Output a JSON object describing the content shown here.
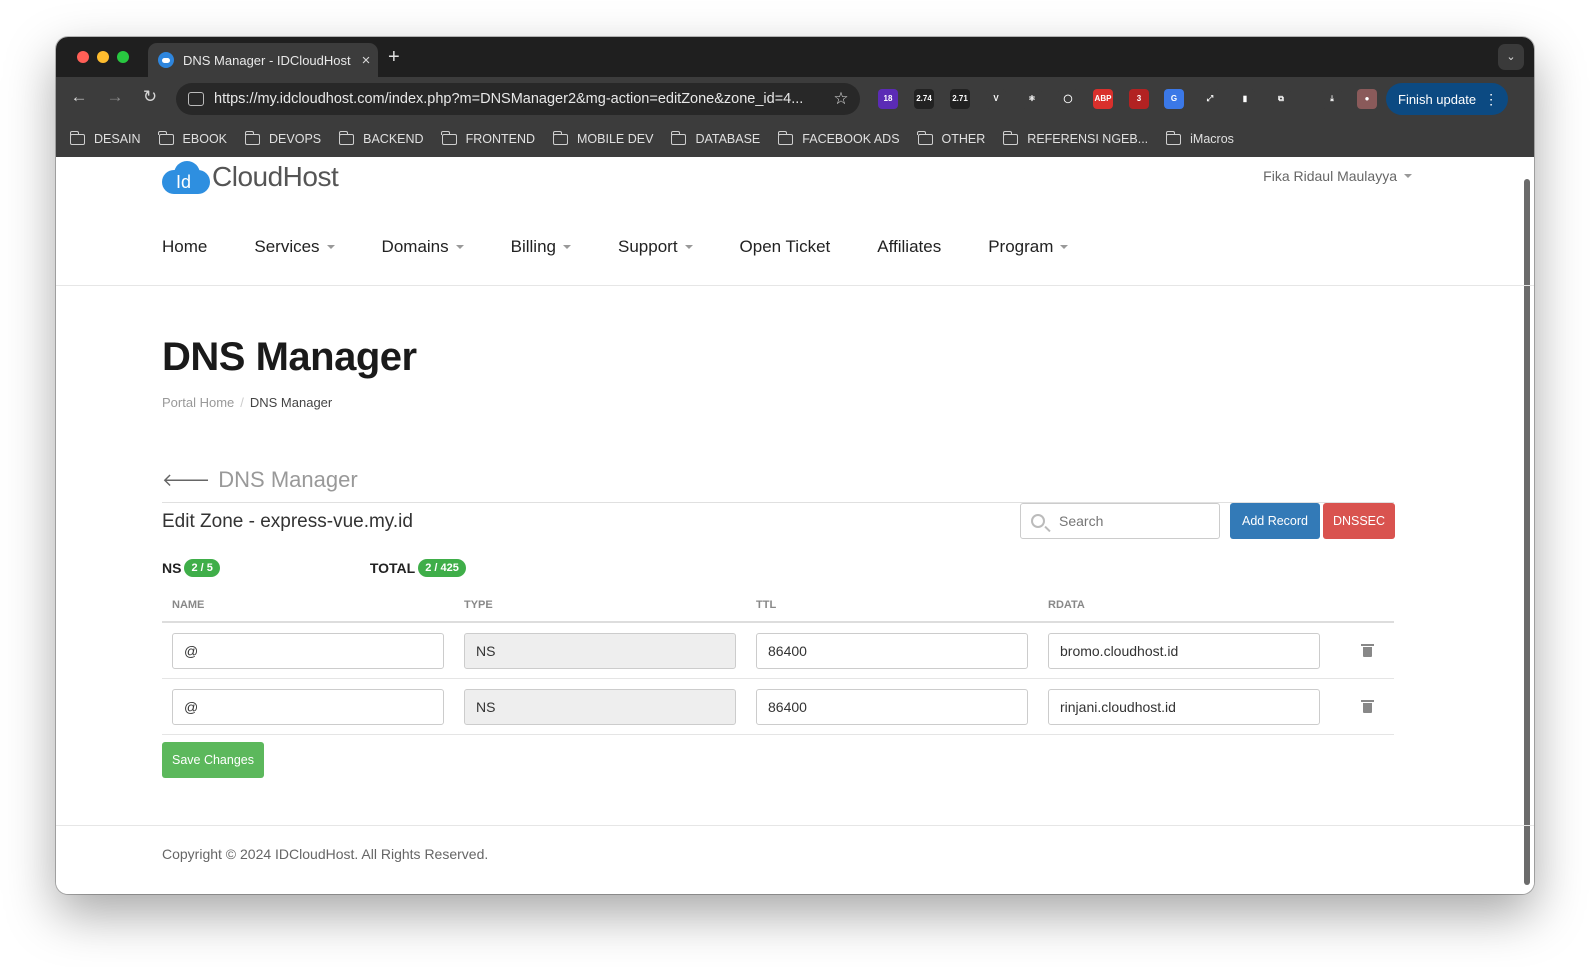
{
  "browser": {
    "tab_title": "DNS Manager - IDCloudHost",
    "tab_close": "×",
    "new_tab": "+",
    "url": "https://my.idcloudhost.com/index.php?m=DNSManager2&mg-action=editZone&zone_id=4...",
    "finish_update": "Finish update",
    "extensions": [
      {
        "name": "ext-badge-18",
        "label": "18",
        "color": "#5b2bb5"
      },
      {
        "name": "ext-2-74",
        "label": "2.74",
        "color": "#222222"
      },
      {
        "name": "ext-lcp-2-71",
        "label": "2.71",
        "color": "#222222"
      },
      {
        "name": "ext-vue",
        "label": "V",
        "color": "#3c3c3c"
      },
      {
        "name": "ext-react",
        "label": "⚛",
        "color": "#3c3c3c"
      },
      {
        "name": "ext-chrome-circle",
        "label": "◯",
        "color": "#3c3c3c"
      },
      {
        "name": "ext-abp",
        "label": "ABP",
        "color": "#d9302c"
      },
      {
        "name": "ext-red-3",
        "label": "3",
        "color": "#b22222"
      },
      {
        "name": "ext-translate",
        "label": "G",
        "color": "#3b78e7"
      },
      {
        "name": "ext-expand",
        "label": "⤢",
        "color": "#3c3c3c"
      },
      {
        "name": "ext-doc",
        "label": "▮",
        "color": "#3c3c3c"
      },
      {
        "name": "ext-puzzle",
        "label": "⧉",
        "color": "#3c3c3c"
      },
      {
        "name": "download",
        "label": "⤓",
        "color": "#3c3c3c"
      },
      {
        "name": "profile",
        "label": "●",
        "color": "#8a5a5a"
      }
    ],
    "bookmarks": [
      "DESAIN",
      "EBOOK",
      "DEVOPS",
      "BACKEND",
      "FRONTEND",
      "MOBILE DEV",
      "DATABASE",
      "FACEBOOK ADS",
      "OTHER",
      "REFERENSI NGEB...",
      "iMacros"
    ]
  },
  "header": {
    "logo_id": "Id",
    "logo_text": "CloudHost",
    "user_name": "Fika Ridaul Maulayya"
  },
  "nav": {
    "home": "Home",
    "services": "Services",
    "domains": "Domains",
    "billing": "Billing",
    "support": "Support",
    "open_ticket": "Open Ticket",
    "affiliates": "Affiliates",
    "program": "Program"
  },
  "page": {
    "title": "DNS Manager",
    "breadcrumb": {
      "home": "Portal Home",
      "sep": "/",
      "current": "DNS Manager"
    },
    "section_back": "DNS Manager",
    "zone_title": "Edit Zone - express-vue.my.id",
    "search_placeholder": "Search",
    "add_record": "Add Record",
    "dnssec": "DNSSEC",
    "counters": {
      "ns_label": "NS",
      "ns_badge": "2 / 5",
      "total_label": "TOTAL",
      "total_badge": "2 / 425"
    },
    "table": {
      "headers": {
        "name": "NAME",
        "type": "TYPE",
        "ttl": "TTL",
        "rdata": "RDATA"
      },
      "rows": [
        {
          "name": "@",
          "type": "NS",
          "ttl": "86400",
          "rdata": "bromo.cloudhost.id"
        },
        {
          "name": "@",
          "type": "NS",
          "ttl": "86400",
          "rdata": "rinjani.cloudhost.id"
        }
      ]
    },
    "save_changes": "Save Changes",
    "footer": "Copyright © 2024 IDCloudHost. All Rights Reserved."
  }
}
